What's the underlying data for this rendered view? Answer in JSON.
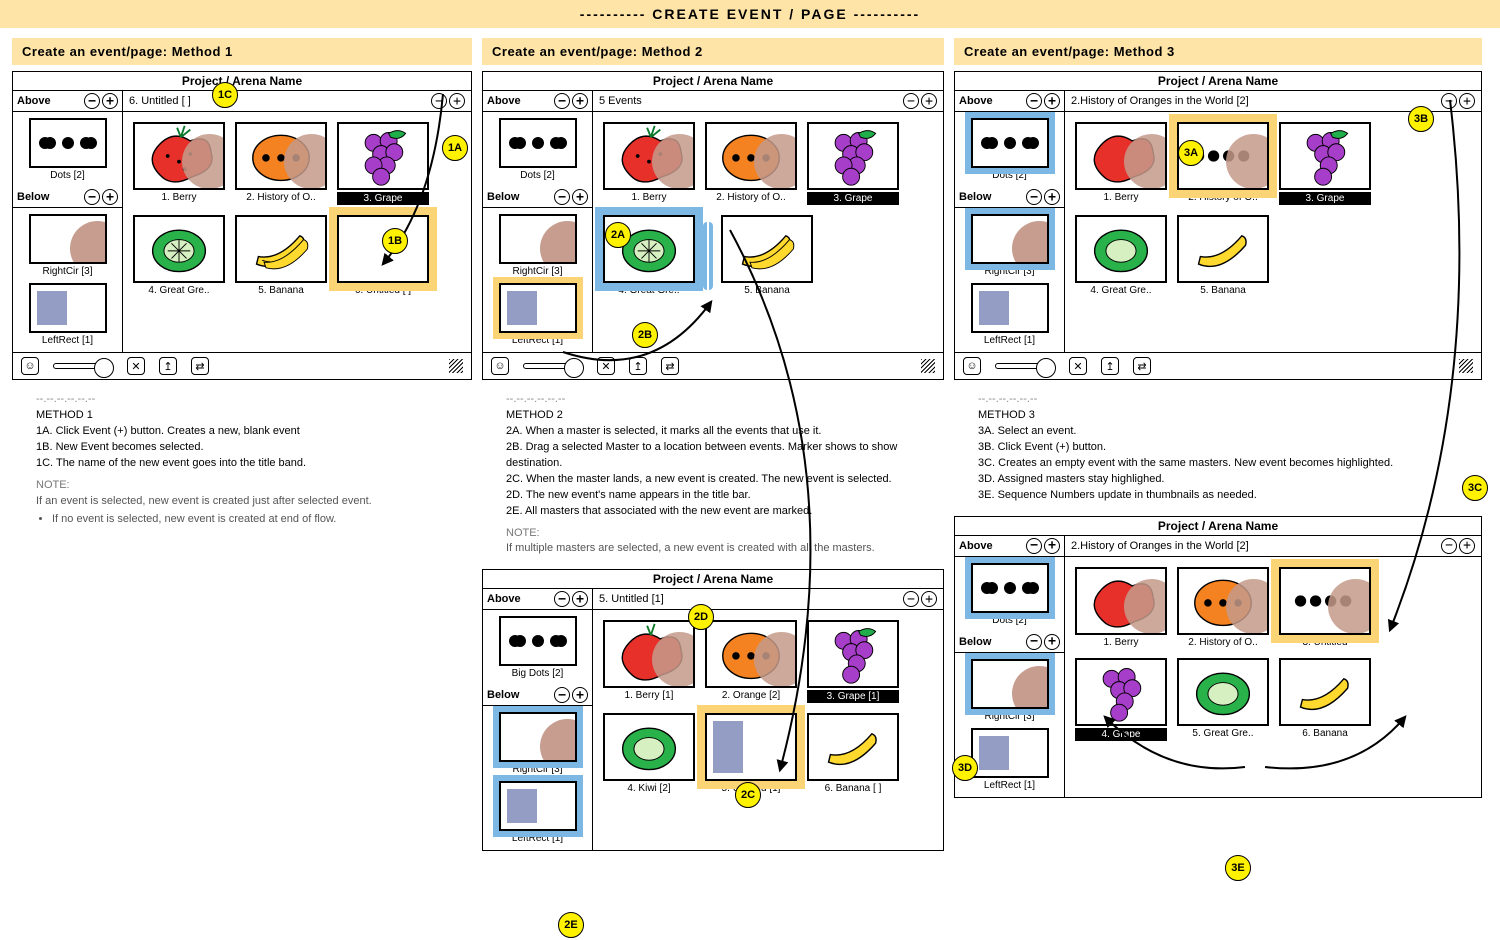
{
  "page_title": "----------  CREATE  EVENT / PAGE  ----------",
  "headers": {
    "m1": "Create an event/page:   Method 1",
    "m2": "Create an event/page:   Method 2",
    "m3": "Create an event/page:   Method 3"
  },
  "frame": {
    "title": "Project / Arena Name",
    "above": "Above",
    "below": "Below"
  },
  "masters": {
    "dots": "Dots  [2]",
    "bigdots": "Big Dots  [2]",
    "rightcir": "RightCir [3]",
    "leftrect": "LeftRect [1]"
  },
  "strip_titles": {
    "m1": "6. Untitled  [ ]",
    "m2a": "5 Events",
    "m2b": "5. Untitled [1]",
    "m3a": "2.History of Oranges in the World [2]",
    "m3b": "2.History of Oranges in the World [2]"
  },
  "events": {
    "berry": "1. Berry",
    "berry1": "1. Berry  [1]",
    "history": "2. History of O..",
    "orange2": "2. Orange  [2]",
    "grape": "3. Grape",
    "grape1": "3. Grape  [1]",
    "greatgre": "4. Great Gre..",
    "kiwi2": "4. Kiwi  [2]",
    "banana": "5. Banana",
    "untitled5": "5. Untitled  [1]",
    "banana6": "6. Banana  [ ]",
    "untitled6": "6. Untitled  [ ]",
    "m3_untitled3": "3. Untitled",
    "m3_grape4": "4. Grape",
    "m3_great5": "5. Great Gre..",
    "m3_banana6": "6. Banana"
  },
  "callouts": {
    "a1": "1A",
    "b1": "1B",
    "c1": "1C",
    "a2": "2A",
    "b2": "2B",
    "c2": "2C",
    "d2": "2D",
    "e2": "2E",
    "a3": "3A",
    "b3": "3B",
    "c3": "3C",
    "d3": "3D",
    "e3": "3E"
  },
  "notes": {
    "m1": {
      "title": "METHOD 1",
      "lines": [
        "1A. Click Event (+) button. Creates a new, blank event",
        "1B. New Event becomes selected.",
        "1C. The name of the new event goes into the title band."
      ],
      "note_label": "NOTE:",
      "note_lines": [
        "If an event is selected, new event is created just after selected event.",
        "If no event is selected, new event is created at end of flow."
      ]
    },
    "m2": {
      "title": "METHOD 2",
      "lines": [
        "2A. When a master is selected, it marks all the events that use it.",
        "2B. Drag a selected Master to a location between events. Marker shows to show destination.",
        "2C. When the master lands, a new event is created.  The new event is selected.",
        "2D. The new event's name appears in the title bar.",
        "2E. All masters that associated with the new event are marked."
      ],
      "note_label": "NOTE:",
      "note_lines": [
        "If multiple masters are selected, a new event is created with all the masters."
      ]
    },
    "m3": {
      "title": "METHOD 3",
      "lines": [
        "3A.  Select an event.",
        "3B.  Click Event (+) button.",
        "3C. Creates an empty event with the same masters.  New event becomes highlighted.",
        "3D.  Assigned masters stay highlighed.",
        "3E.  Sequence Numbers update in thumbnails as needed."
      ]
    }
  }
}
